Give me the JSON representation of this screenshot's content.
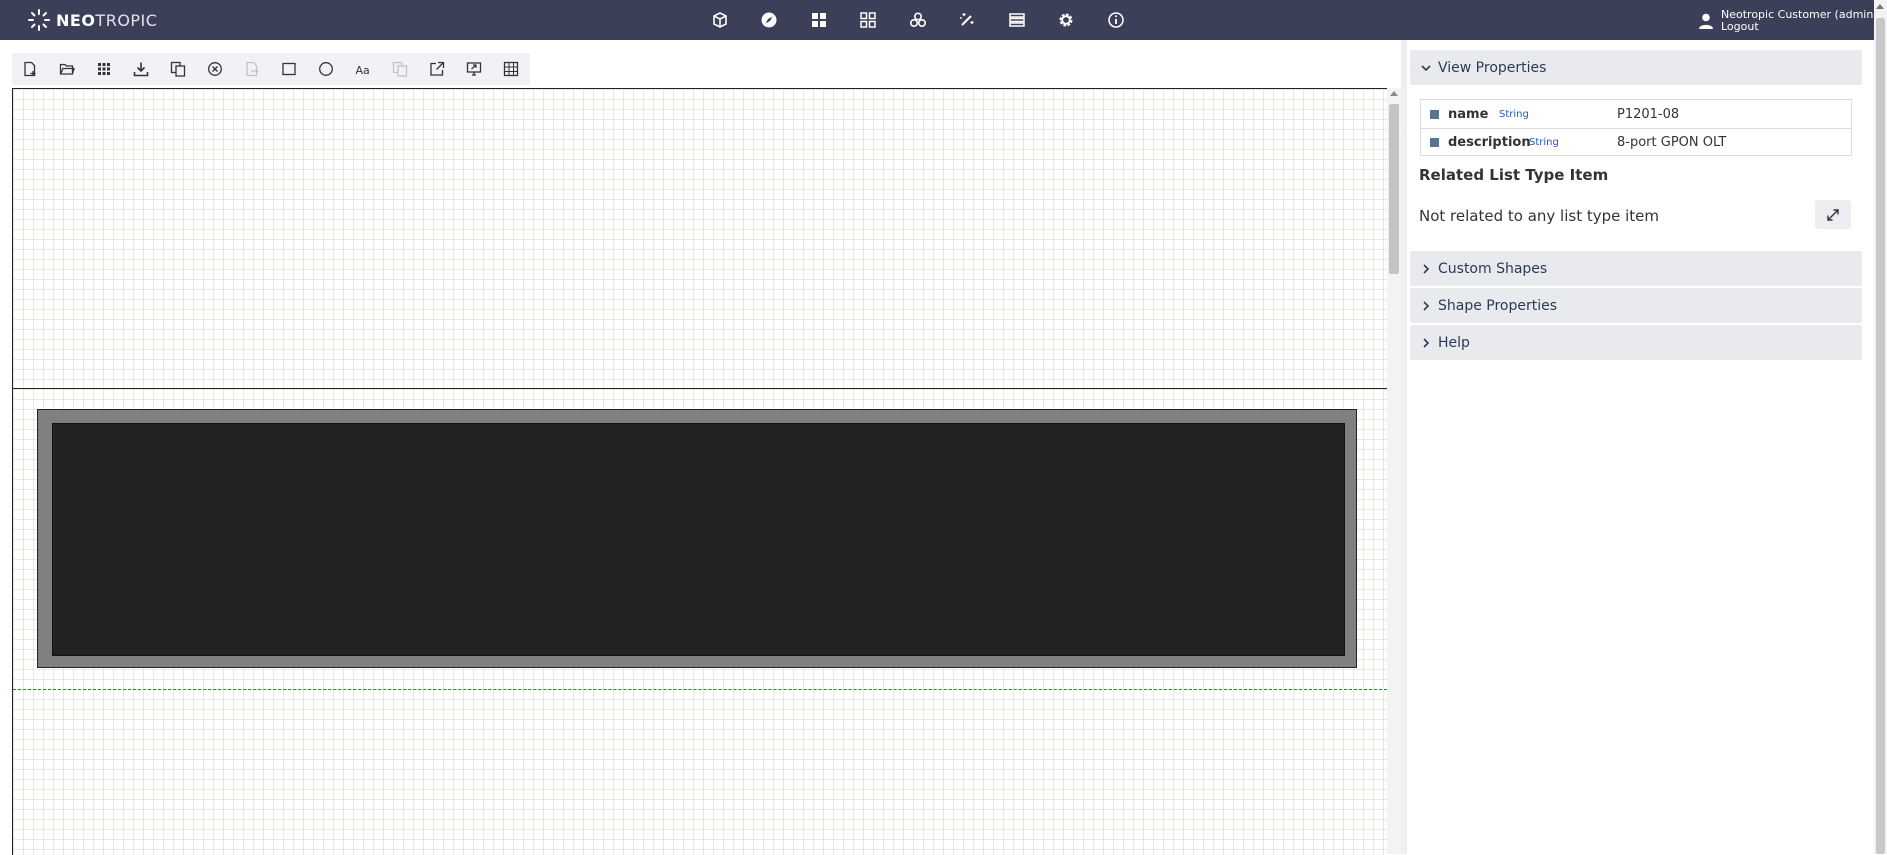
{
  "app": {
    "logo_bold": "NEO",
    "logo_light": "TROPIC",
    "brand_color": "#3c3f58"
  },
  "topnav": {
    "icons": [
      "cube-icon",
      "compass-icon",
      "dashboard-icon",
      "grid-icon",
      "cluster-icon",
      "magic-wand-icon",
      "list-icon",
      "gear-icon",
      "info-icon"
    ]
  },
  "user": {
    "name": "Neotropic Customer (admin)",
    "logout": "Logout",
    "icon": "user-icon"
  },
  "toolbar": {
    "icons": [
      "new-file-icon",
      "open-folder-icon",
      "palette-icon",
      "download-icon",
      "copy-icon",
      "delete-circle-icon",
      "disabled-export-icon",
      "rectangle-icon",
      "circle-icon",
      "text-icon",
      "disabled-duplicate-icon",
      "open-external-icon",
      "screen-export-icon",
      "table-grid-icon"
    ]
  },
  "canvas": {
    "grid_color": "#e3ecd9",
    "rack_outer_color": "#808080",
    "rack_inner_color": "#222222"
  },
  "view_properties": {
    "title": "View Properties",
    "properties": [
      {
        "name": "name",
        "type": "String",
        "value": "P1201-08"
      },
      {
        "name": "description",
        "type": "String",
        "value": "8-port GPON OLT"
      }
    ],
    "related_title": "Related List Type Item",
    "related_text": "Not related to any list type item",
    "related_button_icon": "arrows-expand-icon"
  },
  "sections": [
    {
      "title": "Custom Shapes"
    },
    {
      "title": "Shape Properties"
    },
    {
      "title": "Help"
    }
  ]
}
